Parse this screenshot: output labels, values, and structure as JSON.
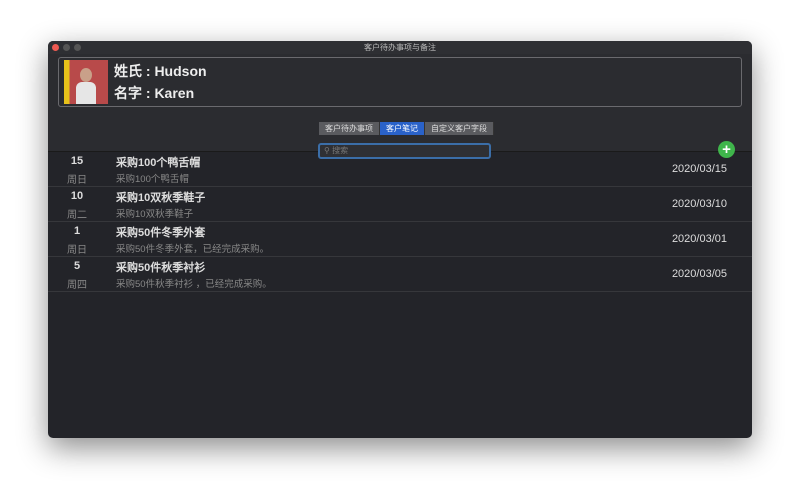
{
  "window": {
    "title": "客户待办事项与备注"
  },
  "customer": {
    "last_name": "姓氏 : Hudson",
    "first_name": "名字 : Karen"
  },
  "tabs": [
    {
      "label": "客户待办事项"
    },
    {
      "label": "客户笔记",
      "active": true
    },
    {
      "label": "自定义客户字段"
    }
  ],
  "search": {
    "placeholder": "搜索"
  },
  "add_label": "+",
  "notes": [
    {
      "day": "15",
      "weekday": "周日",
      "title": "采购100个鸭舌帽",
      "detail": "采购100个鸭舌帽",
      "date": "2020/03/15"
    },
    {
      "day": "10",
      "weekday": "周二",
      "title": "采购10双秋季鞋子",
      "detail": "采购10双秋季鞋子",
      "date": "2020/03/10"
    },
    {
      "day": "1",
      "weekday": "周日",
      "title": "采购50件冬季外套",
      "detail": "采购50件冬季外套，已经完成采购。",
      "date": "2020/03/01"
    },
    {
      "day": "5",
      "weekday": "周四",
      "title": "采购50件秋季衬衫",
      "detail": "采购50件秋季衬衫 ，已经完成采购。",
      "date": "2020/03/05"
    }
  ]
}
